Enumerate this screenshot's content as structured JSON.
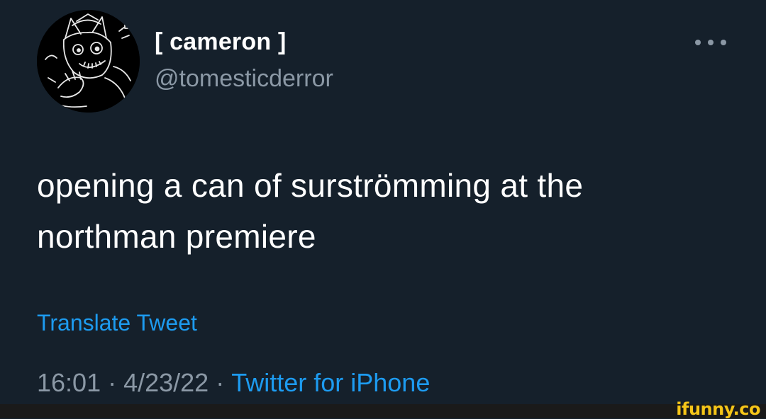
{
  "user": {
    "display_name": "[ cameron ]",
    "handle": "@tomesticderror",
    "avatar_icon": "cartoon-cat-avatar"
  },
  "tweet": {
    "text_lines": [
      "opening a can of surströmming at the",
      "northman premiere"
    ],
    "translate_label": "Translate Tweet",
    "time": "16:01",
    "date": "4/23/22",
    "separator": "·",
    "source": "Twitter for iPhone"
  },
  "menu": {
    "icon": "more-options-icon"
  },
  "watermark": {
    "text": "ifunny.co"
  },
  "colors": {
    "background": "#15202b",
    "text": "#ffffff",
    "secondary": "#8b98a5",
    "link": "#1d9bf0",
    "watermark": "#f5c518"
  }
}
